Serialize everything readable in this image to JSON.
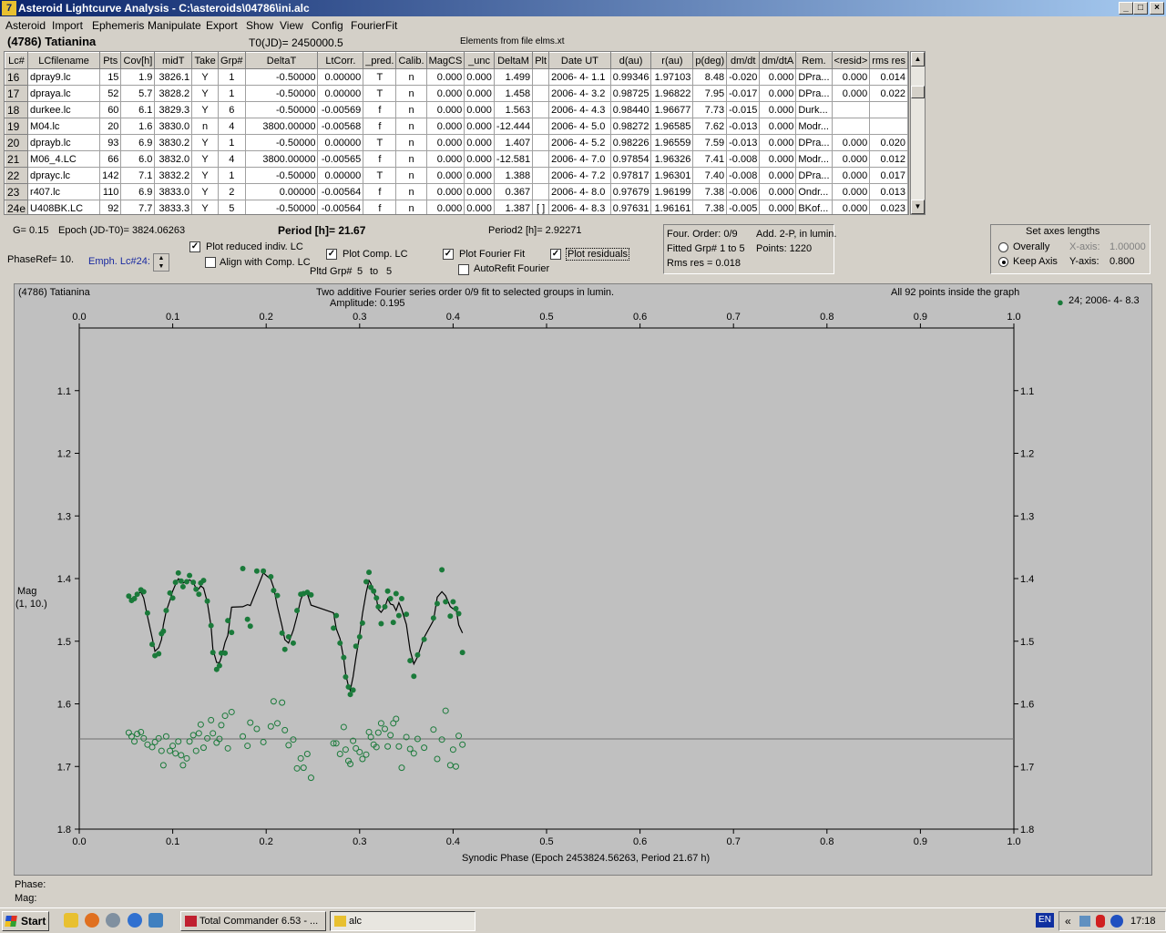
{
  "window": {
    "title": "Asteroid Lightcurve Analysis - C:\\asteroids\\04786\\ini.alc"
  },
  "menu": [
    "Asteroid",
    "Import",
    "Ephemeris",
    "Manipulate",
    "Export",
    "Show",
    "View",
    "Config",
    "FourierFit"
  ],
  "header": {
    "asteroid": "(4786) Tatianina",
    "t0": "T0(JD)= 2450000.5",
    "elements": "Elements from file elms.xt"
  },
  "table": {
    "columns": [
      "Lc#",
      "LCfilename",
      "Pts",
      "Cov[h]",
      "midT",
      "Take",
      "Grp#",
      "DeltaT",
      "LtCorr.",
      "_pred.",
      "Calib.",
      "MagCS",
      "_unc",
      "DeltaM",
      "Plt",
      "Date UT",
      "d(au)",
      "r(au)",
      "p(deg)",
      "dm/dt",
      "dm/dtA",
      "Rem.",
      "<resid>",
      "rms res"
    ],
    "rows": [
      [
        "16",
        "dpray9.lc",
        "15",
        "1.9",
        "3826.1",
        "Y",
        "1",
        "-0.50000",
        "0.00000",
        "T",
        "n",
        "0.000",
        "0.000",
        "1.499",
        "",
        "2006- 4- 1.1",
        "0.99346",
        "1.97103",
        "8.48",
        "-0.020",
        "0.000",
        "DPra...",
        "0.000",
        "0.014"
      ],
      [
        "17",
        "dpraya.lc",
        "52",
        "5.7",
        "3828.2",
        "Y",
        "1",
        "-0.50000",
        "0.00000",
        "T",
        "n",
        "0.000",
        "0.000",
        "1.458",
        "",
        "2006- 4- 3.2",
        "0.98725",
        "1.96822",
        "7.95",
        "-0.017",
        "0.000",
        "DPra...",
        "0.000",
        "0.022"
      ],
      [
        "18",
        "durkee.lc",
        "60",
        "6.1",
        "3829.3",
        "Y",
        "6",
        "-0.50000",
        "-0.00569",
        "f",
        "n",
        "0.000",
        "0.000",
        "1.563",
        "",
        "2006- 4- 4.3",
        "0.98440",
        "1.96677",
        "7.73",
        "-0.015",
        "0.000",
        "Durk...",
        "",
        ""
      ],
      [
        "19",
        "M04.lc",
        "20",
        "1.6",
        "3830.0",
        "n",
        "4",
        "3800.00000",
        "-0.00568",
        "f",
        "n",
        "0.000",
        "0.000",
        "-12.444",
        "",
        "2006- 4- 5.0",
        "0.98272",
        "1.96585",
        "7.62",
        "-0.013",
        "0.000",
        "Modr...",
        "",
        ""
      ],
      [
        "20",
        "dprayb.lc",
        "93",
        "6.9",
        "3830.2",
        "Y",
        "1",
        "-0.50000",
        "0.00000",
        "T",
        "n",
        "0.000",
        "0.000",
        "1.407",
        "",
        "2006- 4- 5.2",
        "0.98226",
        "1.96559",
        "7.59",
        "-0.013",
        "0.000",
        "DPra...",
        "0.000",
        "0.020"
      ],
      [
        "21",
        "M06_4.LC",
        "66",
        "6.0",
        "3832.0",
        "Y",
        "4",
        "3800.00000",
        "-0.00565",
        "f",
        "n",
        "0.000",
        "0.000",
        "-12.581",
        "",
        "2006- 4- 7.0",
        "0.97854",
        "1.96326",
        "7.41",
        "-0.008",
        "0.000",
        "Modr...",
        "0.000",
        "0.012"
      ],
      [
        "22",
        "dprayc.lc",
        "142",
        "7.1",
        "3832.2",
        "Y",
        "1",
        "-0.50000",
        "0.00000",
        "T",
        "n",
        "0.000",
        "0.000",
        "1.388",
        "",
        "2006- 4- 7.2",
        "0.97817",
        "1.96301",
        "7.40",
        "-0.008",
        "0.000",
        "DPra...",
        "0.000",
        "0.017"
      ],
      [
        "23",
        "r407.lc",
        "110",
        "6.9",
        "3833.0",
        "Y",
        "2",
        "0.00000",
        "-0.00564",
        "f",
        "n",
        "0.000",
        "0.000",
        "0.367",
        "",
        "2006- 4- 8.0",
        "0.97679",
        "1.96199",
        "7.38",
        "-0.006",
        "0.000",
        "Ondr...",
        "0.000",
        "0.013"
      ],
      [
        "24e",
        "U408BK.LC",
        "92",
        "7.7",
        "3833.3",
        "Y",
        "5",
        "-0.50000",
        "-0.00564",
        "f",
        "n",
        "0.000",
        "0.000",
        "1.387",
        "[ ]",
        "2006- 4- 8.3",
        "0.97631",
        "1.96161",
        "7.38",
        "-0.005",
        "0.000",
        "BKof...",
        "0.000",
        "0.023"
      ]
    ]
  },
  "controls": {
    "g": "G= 0.15",
    "epoch": "Epoch (JD-T0)= 3824.06263",
    "period": "Period [h]= 21.67",
    "period2": "Period2 [h]= 2.92271",
    "phaseref": "PhaseRef= 10.",
    "emph": "Emph. Lc#24:",
    "plot_reduced": "Plot reduced indiv. LC",
    "align": "Align with Comp. LC",
    "plot_comp": "Plot Comp. LC",
    "plot_fourier": "Plot Fourier Fit",
    "plot_resid": "Plot residuals",
    "autorefit": "AutoRefit Fourier",
    "pltd_grp": "Pltd Grp#",
    "grp_from": "5",
    "grp_to_label": "to",
    "grp_to": "5"
  },
  "fourier_info": {
    "order": "Four. Order:  0/9",
    "add": "Add. 2-P, in lumin.",
    "fitted": "Fitted Grp# 1 to 5",
    "points": "Points: 1220",
    "rms": "Rms res      = 0.018"
  },
  "axes_box": {
    "title": "Set axes lengths",
    "overall": "Overally",
    "keep": "Keep Axis",
    "xlabel": "X-axis:",
    "xval": "1.00000",
    "ylabel": "Y-axis:",
    "yval": "0.800"
  },
  "plot": {
    "name": "(4786) Tatianina",
    "desc": "Two additive Fourier series order 0/9 fit to selected groups in lumin.",
    "amplitude": "Amplitude: 0.195",
    "inside": "All 92 points inside the graph",
    "legend": "24; 2006- 4- 8.3",
    "ylabel1": "Mag",
    "ylabel2": "(1, 10.)",
    "xlabel": "Synodic Phase (Epoch 2453824.56263, Period 21.67 h)",
    "color": "#1a7a3a"
  },
  "chart_data": {
    "type": "scatter",
    "xlim": [
      0,
      1
    ],
    "ylim": [
      1.0,
      1.8
    ],
    "y_inverted": true,
    "xticks": [
      "0.0",
      "0.1",
      "0.2",
      "0.3",
      "0.4",
      "0.5",
      "0.6",
      "0.7",
      "0.8",
      "0.9",
      "1.0"
    ],
    "yticks": [
      "1.1",
      "1.2",
      "1.3",
      "1.4",
      "1.5",
      "1.6",
      "1.7",
      "1.8"
    ],
    "points": [
      [
        0.053,
        1.428
      ],
      [
        0.056,
        1.435
      ],
      [
        0.059,
        1.432
      ],
      [
        0.062,
        1.425
      ],
      [
        0.066,
        1.418
      ],
      [
        0.069,
        1.421
      ],
      [
        0.073,
        1.455
      ],
      [
        0.078,
        1.505
      ],
      [
        0.081,
        1.523
      ],
      [
        0.085,
        1.52
      ],
      [
        0.088,
        1.488
      ],
      [
        0.09,
        1.484
      ],
      [
        0.093,
        1.451
      ],
      [
        0.097,
        1.423
      ],
      [
        0.1,
        1.431
      ],
      [
        0.103,
        1.406
      ],
      [
        0.106,
        1.391
      ],
      [
        0.109,
        1.404
      ],
      [
        0.111,
        1.413
      ],
      [
        0.115,
        1.405
      ],
      [
        0.118,
        1.395
      ],
      [
        0.122,
        1.406
      ],
      [
        0.125,
        1.417
      ],
      [
        0.128,
        1.425
      ],
      [
        0.13,
        1.407
      ],
      [
        0.133,
        1.403
      ],
      [
        0.137,
        1.436
      ],
      [
        0.141,
        1.475
      ],
      [
        0.143,
        1.518
      ],
      [
        0.147,
        1.545
      ],
      [
        0.15,
        1.539
      ],
      [
        0.152,
        1.519
      ],
      [
        0.156,
        1.519
      ],
      [
        0.159,
        1.467
      ],
      [
        0.163,
        1.486
      ],
      [
        0.175,
        1.384
      ],
      [
        0.18,
        1.465
      ],
      [
        0.183,
        1.476
      ],
      [
        0.19,
        1.388
      ],
      [
        0.197,
        1.388
      ],
      [
        0.205,
        1.397
      ],
      [
        0.208,
        1.419
      ],
      [
        0.212,
        1.427
      ],
      [
        0.217,
        1.487
      ],
      [
        0.22,
        1.513
      ],
      [
        0.224,
        1.493
      ],
      [
        0.229,
        1.503
      ],
      [
        0.233,
        1.451
      ],
      [
        0.237,
        1.425
      ],
      [
        0.24,
        1.424
      ],
      [
        0.244,
        1.422
      ],
      [
        0.248,
        1.426
      ],
      [
        0.272,
        1.479
      ],
      [
        0.275,
        1.459
      ],
      [
        0.279,
        1.503
      ],
      [
        0.283,
        1.526
      ],
      [
        0.285,
        1.557
      ],
      [
        0.288,
        1.573
      ],
      [
        0.29,
        1.585
      ],
      [
        0.293,
        1.578
      ],
      [
        0.296,
        1.508
      ],
      [
        0.3,
        1.493
      ],
      [
        0.303,
        1.471
      ],
      [
        0.307,
        1.405
      ],
      [
        0.31,
        1.39
      ],
      [
        0.312,
        1.414
      ],
      [
        0.315,
        1.42
      ],
      [
        0.318,
        1.431
      ],
      [
        0.32,
        1.445
      ],
      [
        0.323,
        1.472
      ],
      [
        0.327,
        1.445
      ],
      [
        0.33,
        1.42
      ],
      [
        0.333,
        1.432
      ],
      [
        0.336,
        1.47
      ],
      [
        0.339,
        1.424
      ],
      [
        0.342,
        1.459
      ],
      [
        0.345,
        1.432
      ],
      [
        0.35,
        1.457
      ],
      [
        0.354,
        1.531
      ],
      [
        0.358,
        1.556
      ],
      [
        0.362,
        1.522
      ],
      [
        0.369,
        1.497
      ],
      [
        0.379,
        1.463
      ],
      [
        0.383,
        1.44
      ],
      [
        0.388,
        1.386
      ],
      [
        0.392,
        1.437
      ],
      [
        0.397,
        1.46
      ],
      [
        0.4,
        1.437
      ],
      [
        0.403,
        1.448
      ],
      [
        0.406,
        1.456
      ],
      [
        0.41,
        1.518
      ]
    ],
    "residuals": [
      [
        0.053,
        1.646
      ],
      [
        0.056,
        1.652
      ],
      [
        0.059,
        1.66
      ],
      [
        0.062,
        1.648
      ],
      [
        0.066,
        1.645
      ],
      [
        0.069,
        1.655
      ],
      [
        0.073,
        1.665
      ],
      [
        0.078,
        1.669
      ],
      [
        0.081,
        1.661
      ],
      [
        0.085,
        1.655
      ],
      [
        0.088,
        1.675
      ],
      [
        0.09,
        1.698
      ],
      [
        0.093,
        1.652
      ],
      [
        0.097,
        1.675
      ],
      [
        0.1,
        1.667
      ],
      [
        0.103,
        1.679
      ],
      [
        0.106,
        1.66
      ],
      [
        0.109,
        1.682
      ],
      [
        0.111,
        1.698
      ],
      [
        0.115,
        1.687
      ],
      [
        0.118,
        1.66
      ],
      [
        0.122,
        1.65
      ],
      [
        0.125,
        1.675
      ],
      [
        0.128,
        1.647
      ],
      [
        0.13,
        1.633
      ],
      [
        0.133,
        1.67
      ],
      [
        0.137,
        1.655
      ],
      [
        0.141,
        1.626
      ],
      [
        0.143,
        1.647
      ],
      [
        0.147,
        1.662
      ],
      [
        0.15,
        1.656
      ],
      [
        0.152,
        1.634
      ],
      [
        0.156,
        1.619
      ],
      [
        0.159,
        1.671
      ],
      [
        0.163,
        1.613
      ],
      [
        0.175,
        1.652
      ],
      [
        0.18,
        1.667
      ],
      [
        0.183,
        1.63
      ],
      [
        0.19,
        1.64
      ],
      [
        0.197,
        1.661
      ],
      [
        0.205,
        1.636
      ],
      [
        0.208,
        1.596
      ],
      [
        0.212,
        1.631
      ],
      [
        0.217,
        1.598
      ],
      [
        0.22,
        1.642
      ],
      [
        0.224,
        1.666
      ],
      [
        0.229,
        1.657
      ],
      [
        0.233,
        1.703
      ],
      [
        0.237,
        1.687
      ],
      [
        0.24,
        1.702
      ],
      [
        0.244,
        1.68
      ],
      [
        0.248,
        1.718
      ],
      [
        0.272,
        1.663
      ],
      [
        0.275,
        1.663
      ],
      [
        0.279,
        1.68
      ],
      [
        0.283,
        1.637
      ],
      [
        0.285,
        1.673
      ],
      [
        0.288,
        1.691
      ],
      [
        0.29,
        1.696
      ],
      [
        0.293,
        1.659
      ],
      [
        0.296,
        1.671
      ],
      [
        0.3,
        1.677
      ],
      [
        0.303,
        1.688
      ],
      [
        0.307,
        1.681
      ],
      [
        0.31,
        1.645
      ],
      [
        0.312,
        1.653
      ],
      [
        0.315,
        1.665
      ],
      [
        0.318,
        1.669
      ],
      [
        0.32,
        1.646
      ],
      [
        0.323,
        1.631
      ],
      [
        0.327,
        1.64
      ],
      [
        0.33,
        1.668
      ],
      [
        0.333,
        1.65
      ],
      [
        0.336,
        1.631
      ],
      [
        0.339,
        1.624
      ],
      [
        0.342,
        1.668
      ],
      [
        0.345,
        1.702
      ],
      [
        0.35,
        1.653
      ],
      [
        0.354,
        1.672
      ],
      [
        0.358,
        1.679
      ],
      [
        0.362,
        1.656
      ],
      [
        0.369,
        1.67
      ],
      [
        0.379,
        1.641
      ],
      [
        0.383,
        1.688
      ],
      [
        0.388,
        1.657
      ],
      [
        0.392,
        1.611
      ],
      [
        0.397,
        1.698
      ],
      [
        0.4,
        1.673
      ],
      [
        0.403,
        1.7
      ],
      [
        0.406,
        1.651
      ],
      [
        0.41,
        1.665
      ]
    ],
    "residual_line": 1.656
  }
}
